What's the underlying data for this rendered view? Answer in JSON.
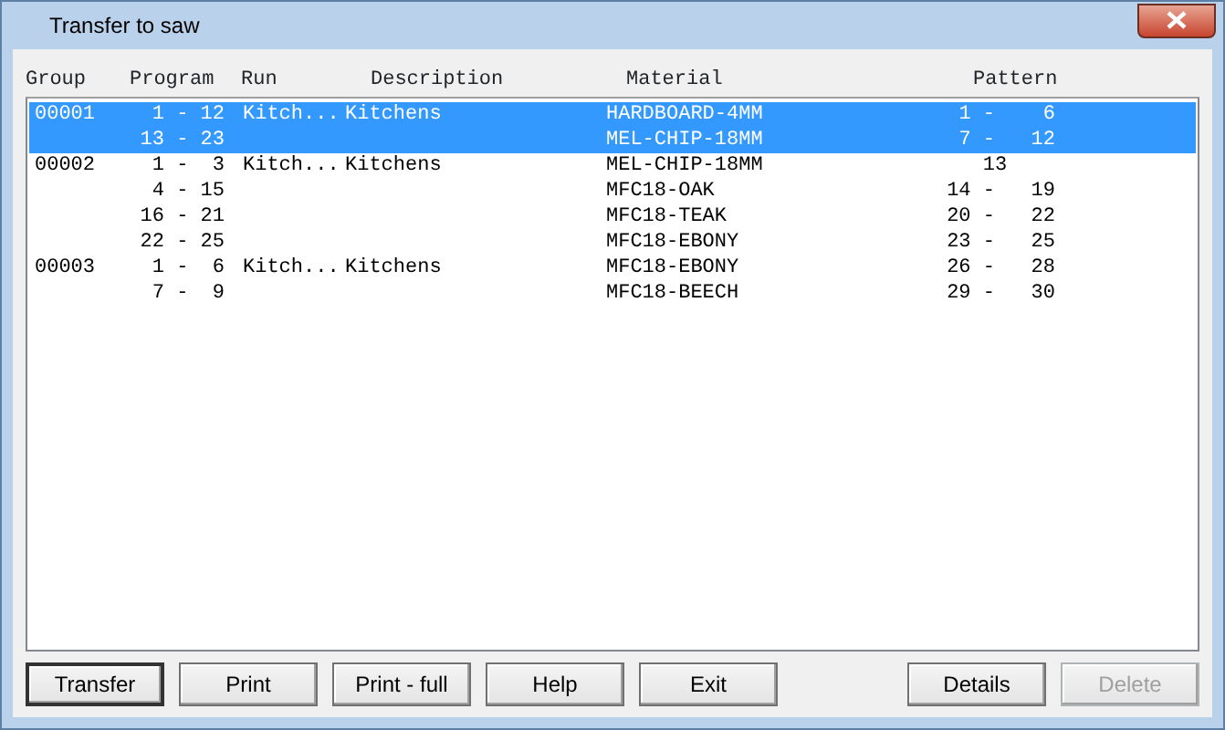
{
  "window": {
    "title": "Transfer to saw"
  },
  "table": {
    "columns": [
      "Group",
      "Program",
      "Run",
      "Description",
      "Material",
      "Pattern"
    ],
    "rows": [
      {
        "group": "00001",
        "program": "1 - 12",
        "run": "Kitch...",
        "description": "Kitchens",
        "material": "HARDBOARD-4MM",
        "pattern": "1 -    6",
        "selected": true
      },
      {
        "program": "13 - 23",
        "material": "MEL-CHIP-18MM",
        "pattern": "7 -   12",
        "selected": true
      },
      {
        "group": "00002",
        "program": "1 -  3",
        "run": "Kitch...",
        "description": "Kitchens",
        "material": "MEL-CHIP-18MM",
        "pattern": "13    ",
        "selected": false
      },
      {
        "program": "4 - 15",
        "material": "MFC18-OAK",
        "pattern": "14 -   19",
        "selected": false
      },
      {
        "program": "16 - 21",
        "material": "MFC18-TEAK",
        "pattern": "20 -   22",
        "selected": false
      },
      {
        "program": "22 - 25",
        "material": "MFC18-EBONY",
        "pattern": "23 -   25",
        "selected": false
      },
      {
        "group": "00003",
        "program": "1 -  6",
        "run": "Kitch...",
        "description": "Kitchens",
        "material": "MFC18-EBONY",
        "pattern": "26 -   28",
        "selected": false
      },
      {
        "program": "7 -  9",
        "material": "MFC18-BEECH",
        "pattern": "29 -   30",
        "selected": false
      }
    ]
  },
  "buttons": [
    {
      "label": "Transfer",
      "default": true,
      "disabled": false
    },
    {
      "label": "Print",
      "default": false,
      "disabled": false
    },
    {
      "label": "Print - full",
      "default": false,
      "disabled": false
    },
    {
      "label": "Help",
      "default": false,
      "disabled": false
    },
    {
      "label": "Exit",
      "default": false,
      "disabled": false
    },
    {
      "label": "Details",
      "default": false,
      "disabled": false,
      "gap": true
    },
    {
      "label": "Delete",
      "default": false,
      "disabled": true
    }
  ]
}
